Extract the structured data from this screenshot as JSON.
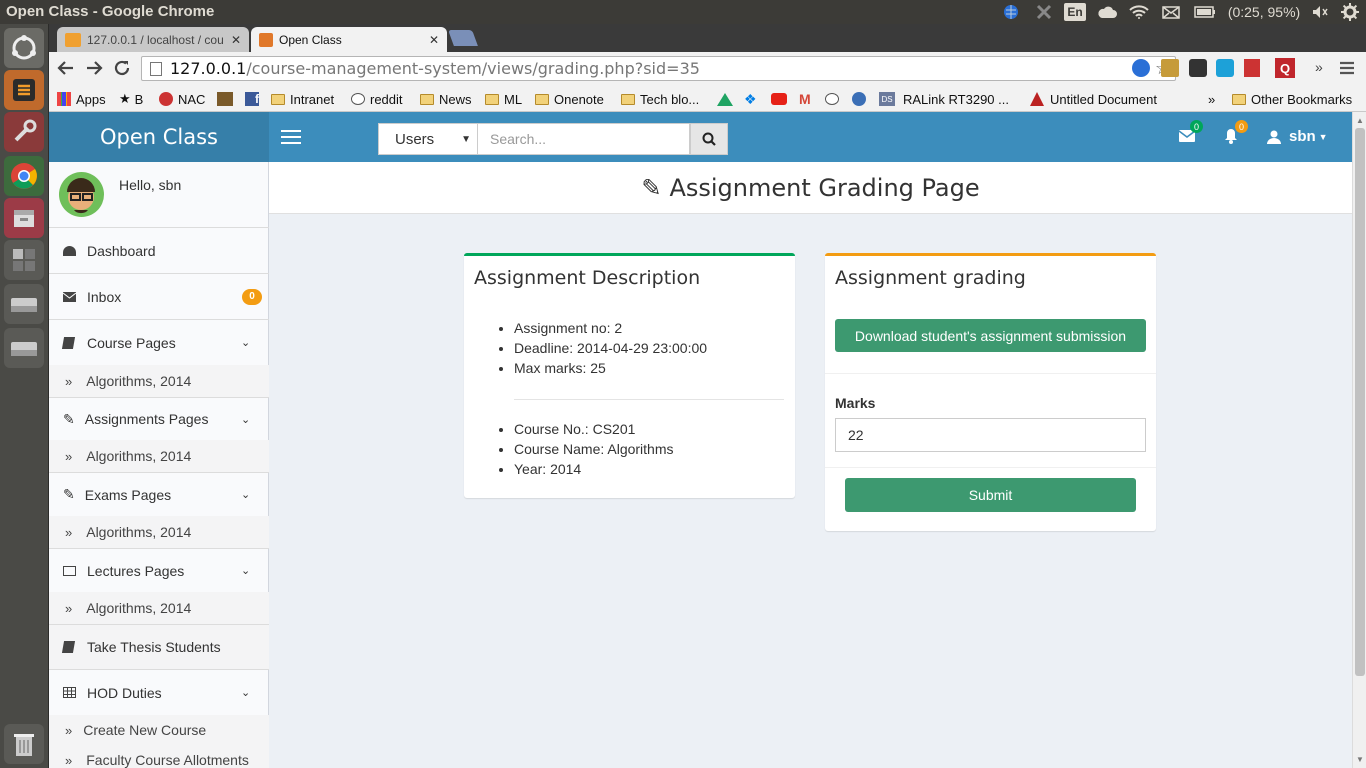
{
  "os": {
    "window_title": "Open Class - Google Chrome",
    "keyboard": "En",
    "battery": "(0:25, 95%)"
  },
  "browser": {
    "tabs": [
      {
        "label": "127.0.0.1 / localhost / cou",
        "active": false
      },
      {
        "label": "Open Class",
        "active": true
      }
    ],
    "url_host": "127.0.0.1",
    "url_path": "/course-management-system/views/grading.php?sid=35",
    "bookmarks": [
      {
        "label": "Apps",
        "icon": "apps-grid-icon"
      },
      {
        "label": "B",
        "icon": "star-icon"
      },
      {
        "label": "NAC",
        "icon": "nac-icon"
      },
      {
        "label": "",
        "icon": "bookmark-image-icon"
      },
      {
        "label": "",
        "icon": "facebook-icon"
      },
      {
        "label": "Intranet",
        "icon": "folder-icon"
      },
      {
        "label": "reddit",
        "icon": "reddit-icon"
      },
      {
        "label": "News",
        "icon": "folder-icon"
      },
      {
        "label": "ML",
        "icon": "folder-icon"
      },
      {
        "label": "Onenote",
        "icon": "folder-icon"
      },
      {
        "label": "Tech blo...",
        "icon": "folder-icon"
      },
      {
        "label": "RALink RT3290 ...",
        "icon": "ds-icon"
      },
      {
        "label": "Untitled Document",
        "icon": "document-icon"
      }
    ],
    "other_bookmarks": "Other Bookmarks",
    "overflow": "»"
  },
  "app": {
    "brand": "Open Class",
    "search_category": "Users",
    "search_placeholder": "Search...",
    "mail_count": "0",
    "notif_count": "0",
    "user_name": "sbn",
    "greeting": "Hello, sbn",
    "menu": {
      "dashboard": "Dashboard",
      "inbox": "Inbox",
      "inbox_badge": "0",
      "course_pages": "Course Pages",
      "course_sub": "Algorithms, 2014",
      "assignments_pages": "Assignments Pages",
      "assignments_sub": "Algorithms, 2014",
      "exams_pages": "Exams Pages",
      "exams_sub": "Algorithms, 2014",
      "lectures_pages": "Lectures Pages",
      "lectures_sub": "Algorithms, 2014",
      "thesis": "Take Thesis Students",
      "hod": "HOD Duties",
      "hod_sub1": "Create New Course",
      "hod_sub2": "Faculty Course Allotments"
    },
    "page_title": "Assignment Grading Page",
    "description": {
      "title": "Assignment Description",
      "items1": [
        "Assignment no: 2",
        "Deadline: 2014-04-29 23:00:00",
        "Max marks: 25"
      ],
      "items2": [
        "Course No.: CS201",
        "Course Name: Algorithms",
        "Year: 2014"
      ]
    },
    "grading": {
      "title": "Assignment grading",
      "download_label": "Download student's assignment submission",
      "marks_label": "Marks",
      "marks_value": "22",
      "submit_label": "Submit"
    }
  },
  "colors": {
    "primary": "#3c8dbc",
    "logo_bg": "#367fa9",
    "green": "#3d9970",
    "box_green_top": "#00a65a",
    "box_orange_top": "#f39c12",
    "badge_orange": "#f39c12"
  }
}
